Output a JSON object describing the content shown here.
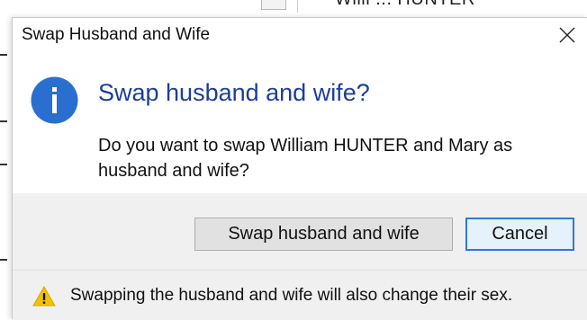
{
  "background": {
    "partial_text": "Willi ... HUNTER"
  },
  "dialog": {
    "title": "Swap Husband and Wife",
    "main_instruction": "Swap husband and wife?",
    "message": "Do you want to swap William HUNTER and Mary  as husband and wife?",
    "buttons": {
      "swap_label": "Swap husband and wife",
      "cancel_label": "Cancel"
    },
    "footer_text": "Swapping the husband and wife will also change their sex.",
    "icons": {
      "main": "info-icon",
      "footer": "warning-icon",
      "close": "close-icon"
    }
  },
  "colors": {
    "instruction": "#1c3e9a",
    "info_icon": "#2a6fd0",
    "warning_icon": "#f2c200",
    "default_button_border": "#2d7ad6"
  }
}
